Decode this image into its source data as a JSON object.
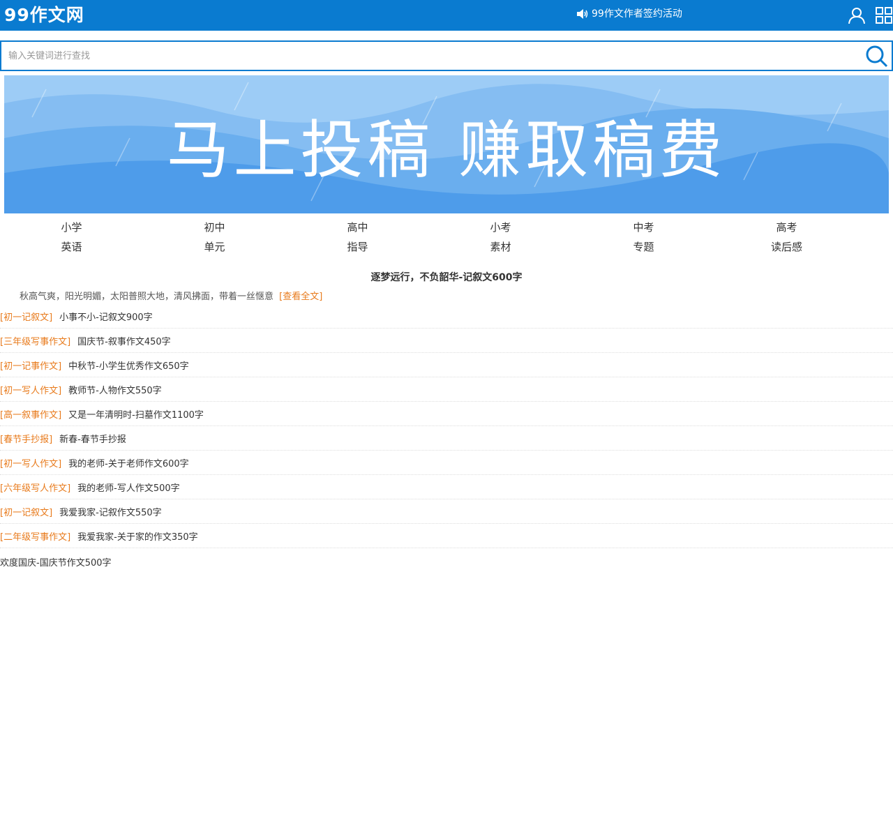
{
  "header": {
    "logo": "99作文网",
    "notice": "99作文作者签约活动",
    "bg_color": "#0a7bd0"
  },
  "search": {
    "placeholder": "输入关键词进行查找"
  },
  "banner": {
    "text": "马上投稿  赚取稿费"
  },
  "categories": {
    "row1": [
      "小学",
      "初中",
      "高中",
      "小考",
      "中考",
      "高考"
    ],
    "row2": [
      "英语",
      "单元",
      "指导",
      "素材",
      "专题",
      "读后感"
    ]
  },
  "featured": {
    "title": "逐梦远行，不负韶华-记叙文600字",
    "summary": "秋高气爽，阳光明媚，太阳普照大地，清风拂面，带着一丝惬意",
    "more": "[查看全文]"
  },
  "articles": [
    {
      "tag": "[初一记叙文]",
      "title": "小事不小-记叙文900字"
    },
    {
      "tag": "[三年级写事作文]",
      "title": "国庆节-叙事作文450字"
    },
    {
      "tag": "[初一记事作文]",
      "title": "中秋节-小学生优秀作文650字"
    },
    {
      "tag": "[初一写人作文]",
      "title": "教师节-人物作文550字"
    },
    {
      "tag": "[高一叙事作文]",
      "title": "又是一年清明时-扫墓作文1100字"
    },
    {
      "tag": "[春节手抄报]",
      "title": "新春-春节手抄报"
    },
    {
      "tag": "[初一写人作文]",
      "title": "我的老师-关于老师作文600字"
    },
    {
      "tag": "[六年级写人作文]",
      "title": "我的老师-写人作文500字"
    },
    {
      "tag": "[初一记叙文]",
      "title": "我爱我家-记叙作文550字"
    },
    {
      "tag": "[二年级写事作文]",
      "title": "我爱我家-关于家的作文350字"
    }
  ],
  "last_link": "欢度国庆-国庆节作文500字",
  "colors": {
    "accent": "#0a7bd0",
    "tag": "#e87a1b"
  }
}
